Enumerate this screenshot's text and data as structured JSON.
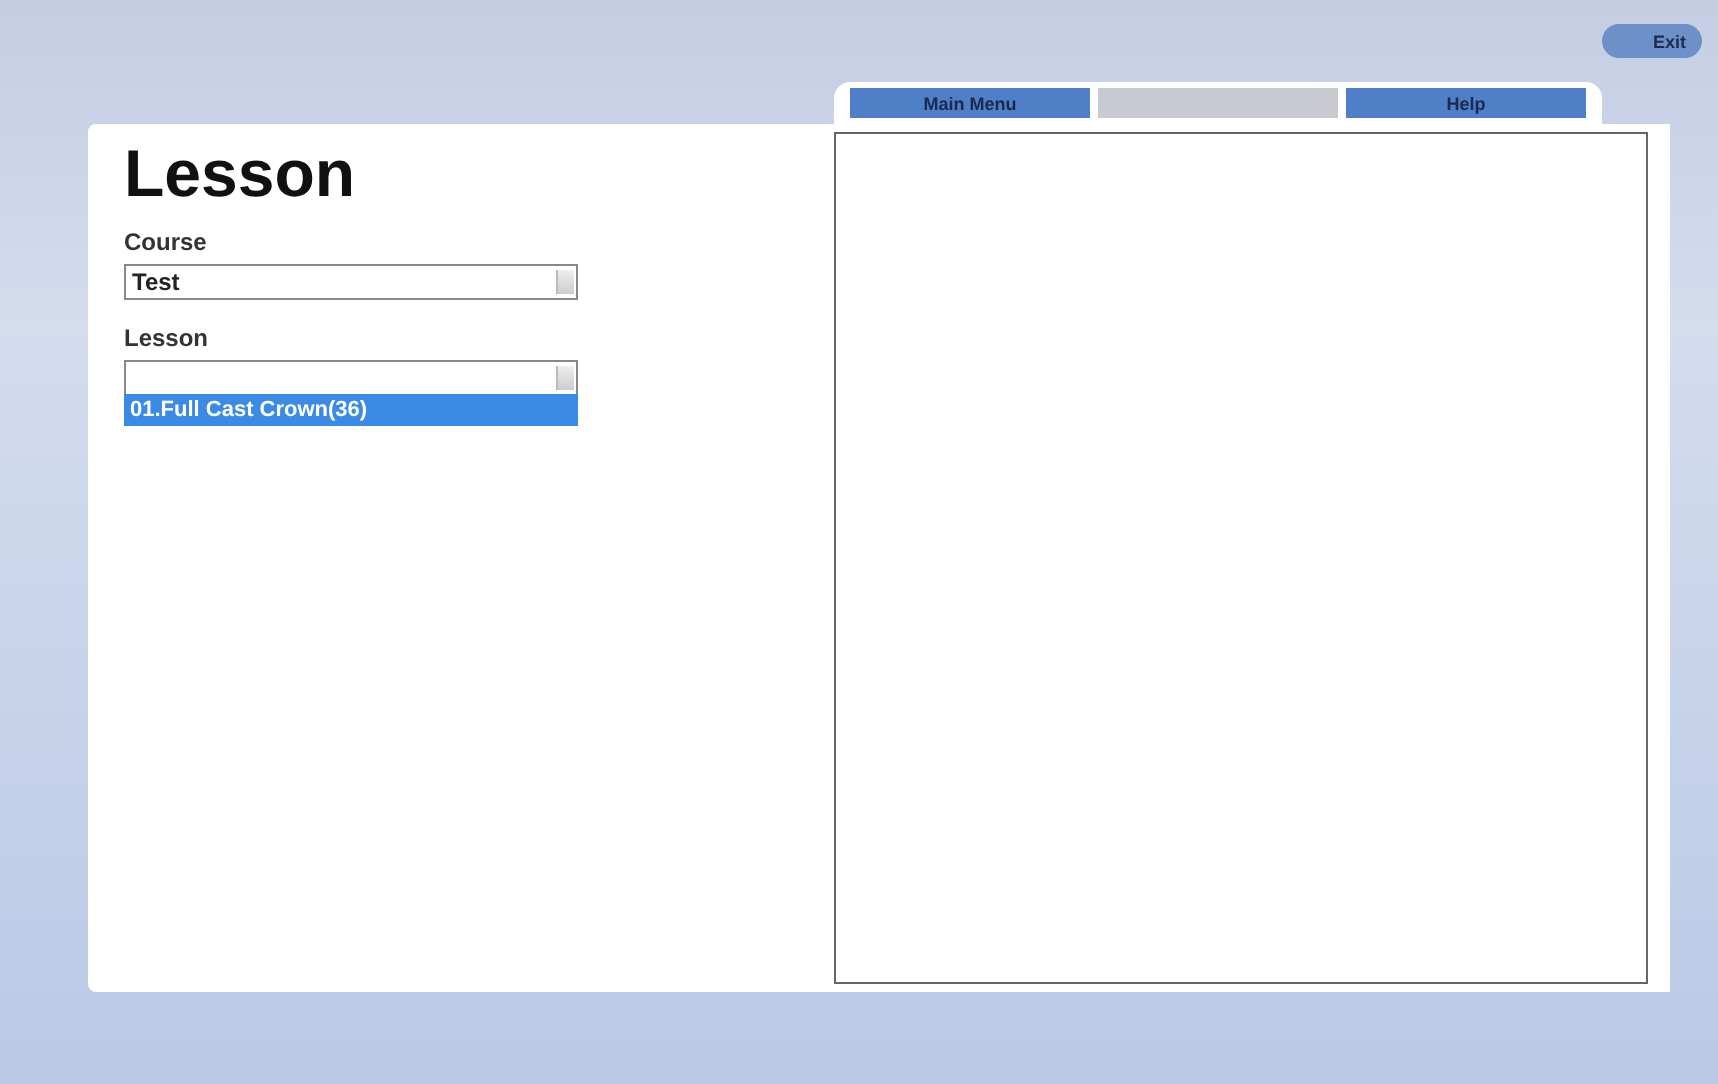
{
  "exit_button": {
    "label": "Exit"
  },
  "tabs": [
    {
      "label": "Main Menu",
      "disabled": false
    },
    {
      "disabled": true
    },
    {
      "label": "Help",
      "disabled": false
    }
  ],
  "title": "Lesson",
  "course": {
    "label": "Course",
    "value": "Test"
  },
  "lesson": {
    "label": "Lesson",
    "options": [
      {
        "label": "01.Full Cast Crown(36)",
        "selected": true
      }
    ]
  }
}
